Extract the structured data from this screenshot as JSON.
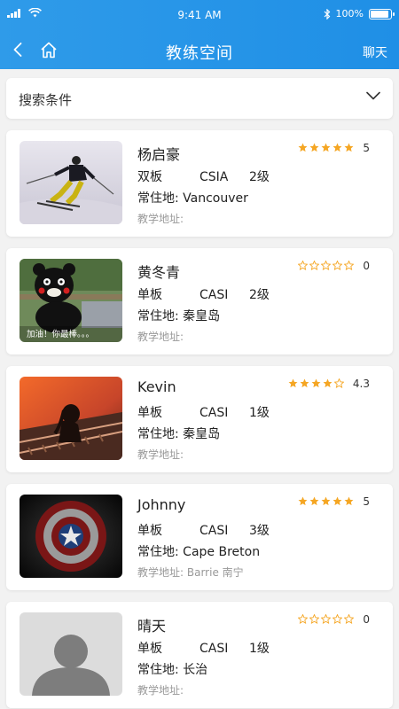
{
  "status_bar": {
    "time": "9:41 AM",
    "battery": "100%"
  },
  "navbar": {
    "title": "教练空间",
    "chat_label": "聊天"
  },
  "search": {
    "label": "搜索条件"
  },
  "colors": {
    "header": "#2196f3",
    "star": "#f5a623",
    "muted": "#999999"
  },
  "coaches": [
    {
      "name": "杨启豪",
      "board": "双板",
      "cert": "CSIA",
      "level": "2级",
      "residence_label": "常住地:",
      "residence": "Vancouver",
      "teaching_label": "教学地址:",
      "teaching": "",
      "rating": "5",
      "stars_filled": 5,
      "avatar": "skier-photo"
    },
    {
      "name": "黄冬青",
      "board": "单板",
      "cert": "CASI",
      "level": "2级",
      "residence_label": "常住地:",
      "residence": "秦皇岛",
      "teaching_label": "教学地址:",
      "teaching": "",
      "rating": "0",
      "stars_filled": 0,
      "avatar": "bear-photo",
      "avatar_caption": "加油！你最棒。。。"
    },
    {
      "name": "Kevin",
      "board": "单板",
      "cert": "CASI",
      "level": "1级",
      "residence_label": "常住地:",
      "residence": "秦皇岛",
      "teaching_label": "教学地址:",
      "teaching": "",
      "rating": "4.3",
      "stars_filled": 4,
      "avatar": "railway-photo"
    },
    {
      "name": "Johnny",
      "board": "单板",
      "cert": "CASI",
      "level": "3级",
      "residence_label": "常住地:",
      "residence": "Cape Breton",
      "teaching_label": "教学地址:",
      "teaching": "Barrie  南宁",
      "rating": "5",
      "stars_filled": 5,
      "avatar": "shield-photo"
    },
    {
      "name": "晴天",
      "board": "单板",
      "cert": "CASI",
      "level": "1级",
      "residence_label": "常住地:",
      "residence": "长治",
      "teaching_label": "教学地址:",
      "teaching": "",
      "rating": "0",
      "stars_filled": 0,
      "avatar": "default-avatar"
    }
  ]
}
